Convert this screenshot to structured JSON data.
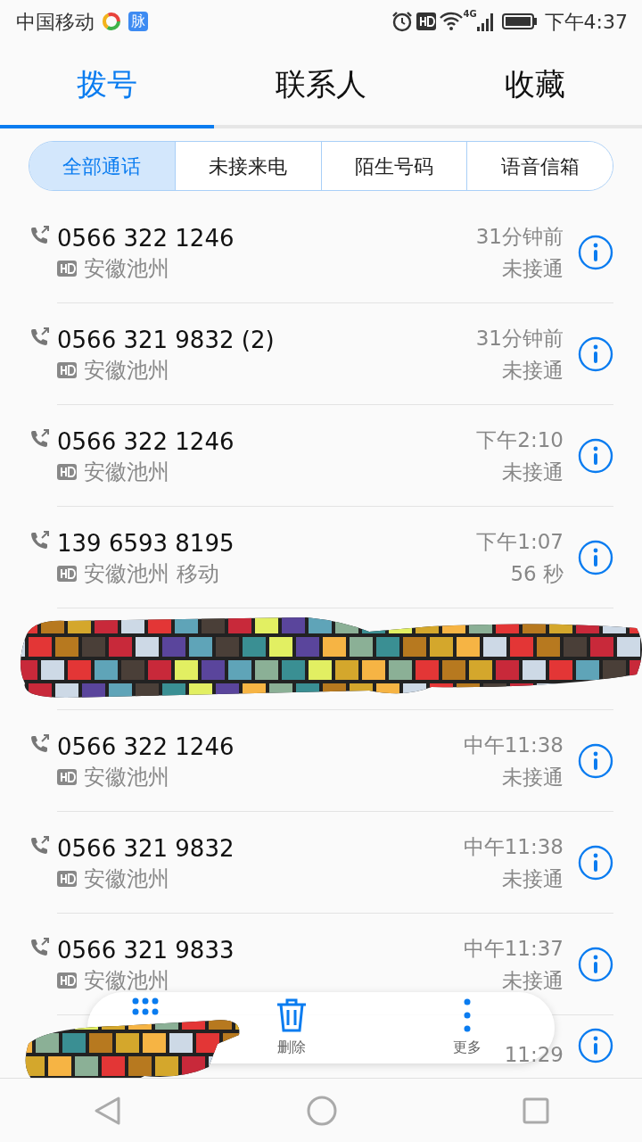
{
  "status_bar": {
    "carrier": "中国移动",
    "app_badge": "脉",
    "network": "4G",
    "time": "下午4:37"
  },
  "tabs": [
    {
      "label": "拨号",
      "selected": true
    },
    {
      "label": "联系人",
      "selected": false
    },
    {
      "label": "收藏",
      "selected": false
    }
  ],
  "filters": [
    {
      "label": "全部通话",
      "selected": true
    },
    {
      "label": "未接来电",
      "selected": false
    },
    {
      "label": "陌生号码",
      "selected": false
    },
    {
      "label": "语音信箱",
      "selected": false
    }
  ],
  "calls": [
    {
      "kind": "call",
      "number": "0566 322 1246",
      "location": "安徽池州",
      "time": "31分钟前",
      "detail": "未接通"
    },
    {
      "kind": "call",
      "number": "0566 321 9832 (2)",
      "location": "安徽池州",
      "time": "31分钟前",
      "detail": "未接通"
    },
    {
      "kind": "call",
      "number": "0566 322 1246",
      "location": "安徽池州",
      "time": "下午2:10",
      "detail": "未接通"
    },
    {
      "kind": "call",
      "number": "139 6593 8195",
      "location": "安徽池州 移动",
      "time": "下午1:07",
      "detail": "56 秒"
    },
    {
      "kind": "redacted"
    },
    {
      "kind": "call",
      "number": "0566 322 1246",
      "location": "安徽池州",
      "time": "中午11:38",
      "detail": "未接通"
    },
    {
      "kind": "call",
      "number": "0566 321 9832",
      "location": "安徽池州",
      "time": "中午11:38",
      "detail": "未接通"
    },
    {
      "kind": "call",
      "number": "0566 321 9833",
      "location": "安徽池州",
      "time": "中午11:37",
      "detail": "未接通"
    },
    {
      "kind": "partial",
      "time": "11:29"
    }
  ],
  "toolbar": [
    {
      "kind": "dialpad"
    },
    {
      "kind": "delete",
      "label": "删除"
    },
    {
      "kind": "more",
      "label": "更多"
    }
  ],
  "nav_bar": [
    {
      "kind": "back"
    },
    {
      "kind": "home"
    },
    {
      "kind": "recents"
    }
  ]
}
